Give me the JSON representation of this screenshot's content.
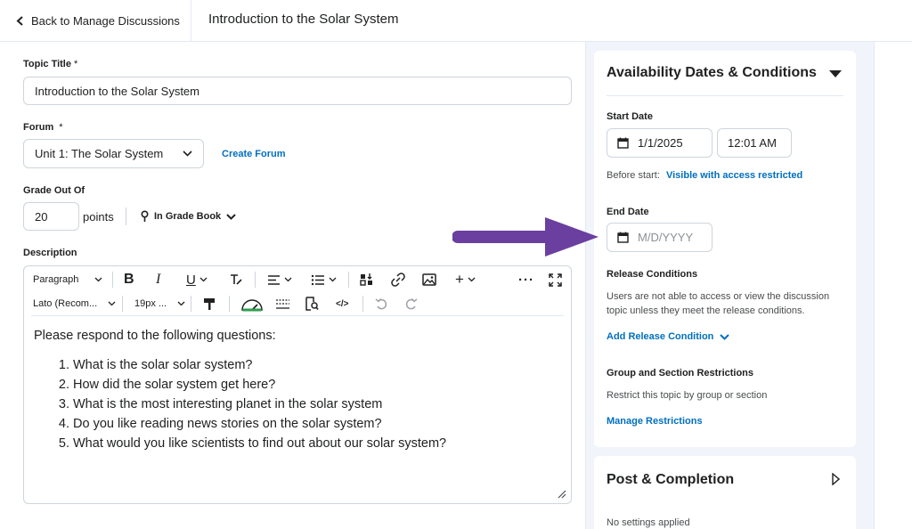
{
  "header": {
    "back_label": "Back to Manage Discussions",
    "title": "Introduction to the Solar System"
  },
  "form": {
    "topic_title_label": "Topic Title",
    "topic_title_required": "*",
    "topic_title_value": "Introduction to the Solar System",
    "forum_label": "Forum",
    "forum_required": "*",
    "forum_value": "Unit 1: The Solar System",
    "create_forum_label": "Create Forum",
    "grade_label": "Grade Out Of",
    "grade_value": "20",
    "grade_unit": "points",
    "gradebook_label": "In Grade Book",
    "description_label": "Description"
  },
  "toolbar": {
    "paragraph": "Paragraph",
    "font": "Lato (Recom...",
    "size": "19px ..."
  },
  "editor": {
    "intro": "Please respond to the following questions:",
    "items": [
      "What is the solar solar system?",
      "How did the solar system get here?",
      "What is the most interesting planet in the solar system",
      "Do you like reading news stories on the solar system?",
      "What would you like scientists to find out about our solar system?"
    ]
  },
  "availability": {
    "title": "Availability Dates & Conditions",
    "start_date_label": "Start Date",
    "start_date_value": "1/1/2025",
    "start_time_value": "12:01 AM",
    "before_start_label": "Before start:",
    "before_start_value": "Visible with access restricted",
    "end_date_label": "End Date",
    "end_date_placeholder": "M/D/YYYY",
    "release_label": "Release Conditions",
    "release_text": "Users are not able to access or view the discussion topic unless they meet the release conditions.",
    "add_release_label": "Add Release Condition",
    "group_label": "Group and Section Restrictions",
    "group_text": "Restrict this topic by group or section",
    "manage_label": "Manage Restrictions"
  },
  "post_completion": {
    "title": "Post & Completion",
    "status": "No settings applied"
  },
  "colors": {
    "link": "#006fbf",
    "accent_arrow": "#6b3fa0",
    "panel_bg": "#f1f5fb"
  }
}
